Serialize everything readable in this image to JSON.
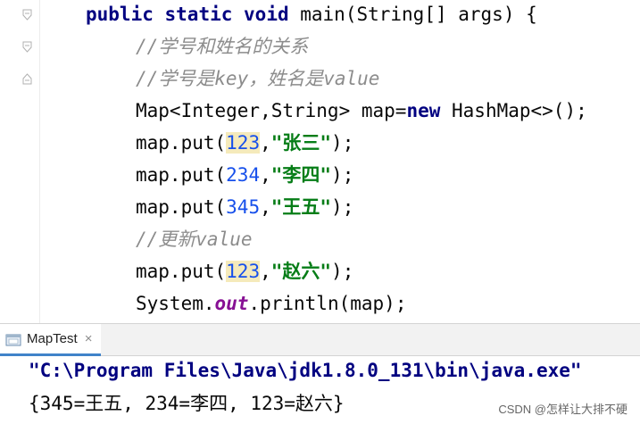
{
  "editor": {
    "line1": {
      "kw1": "public",
      "kw2": "static",
      "kw3": "void",
      "rest": " main(String[] args) {"
    },
    "line2": {
      "comment": "//学号和姓名的关系"
    },
    "line3": {
      "comment": "//学号是key，姓名是value"
    },
    "line4": {
      "pre": "Map<Integer,String> map=",
      "kw": "new",
      "post": " HashMap<>();"
    },
    "line5": {
      "pre": "map.put(",
      "num": "123",
      "comma": ",",
      "str": "\"张三\"",
      "post": ");"
    },
    "line6": {
      "pre": "map.put(",
      "num": "234",
      "comma": ",",
      "str": "\"李四\"",
      "post": ");"
    },
    "line7": {
      "pre": "map.put(",
      "num": "345",
      "comma": ",",
      "str": "\"王五\"",
      "post": ");"
    },
    "line8": {
      "comment": "//更新value"
    },
    "line9": {
      "pre": "map.put(",
      "num": "123",
      "comma": ",",
      "str": "\"赵六\"",
      "post": ");"
    },
    "line10": {
      "pre": "System.",
      "field": "out",
      "post": ".println(map);"
    }
  },
  "run_panel": {
    "tab_label": "MapTest",
    "tab_close": "×",
    "icon": "run-config-icon"
  },
  "console": {
    "command": "\"C:\\Program Files\\Java\\jdk1.8.0_131\\bin\\java.exe\"",
    "output": "{345=王五, 234=李四, 123=赵六}"
  },
  "watermark": "CSDN @怎样让大排不硬",
  "colors": {
    "keyword": "#000080",
    "comment": "#8c8c8c",
    "number": "#1750eb",
    "string": "#067d17",
    "highlight": "#f5eabb",
    "tab_underline": "#4083c9"
  }
}
